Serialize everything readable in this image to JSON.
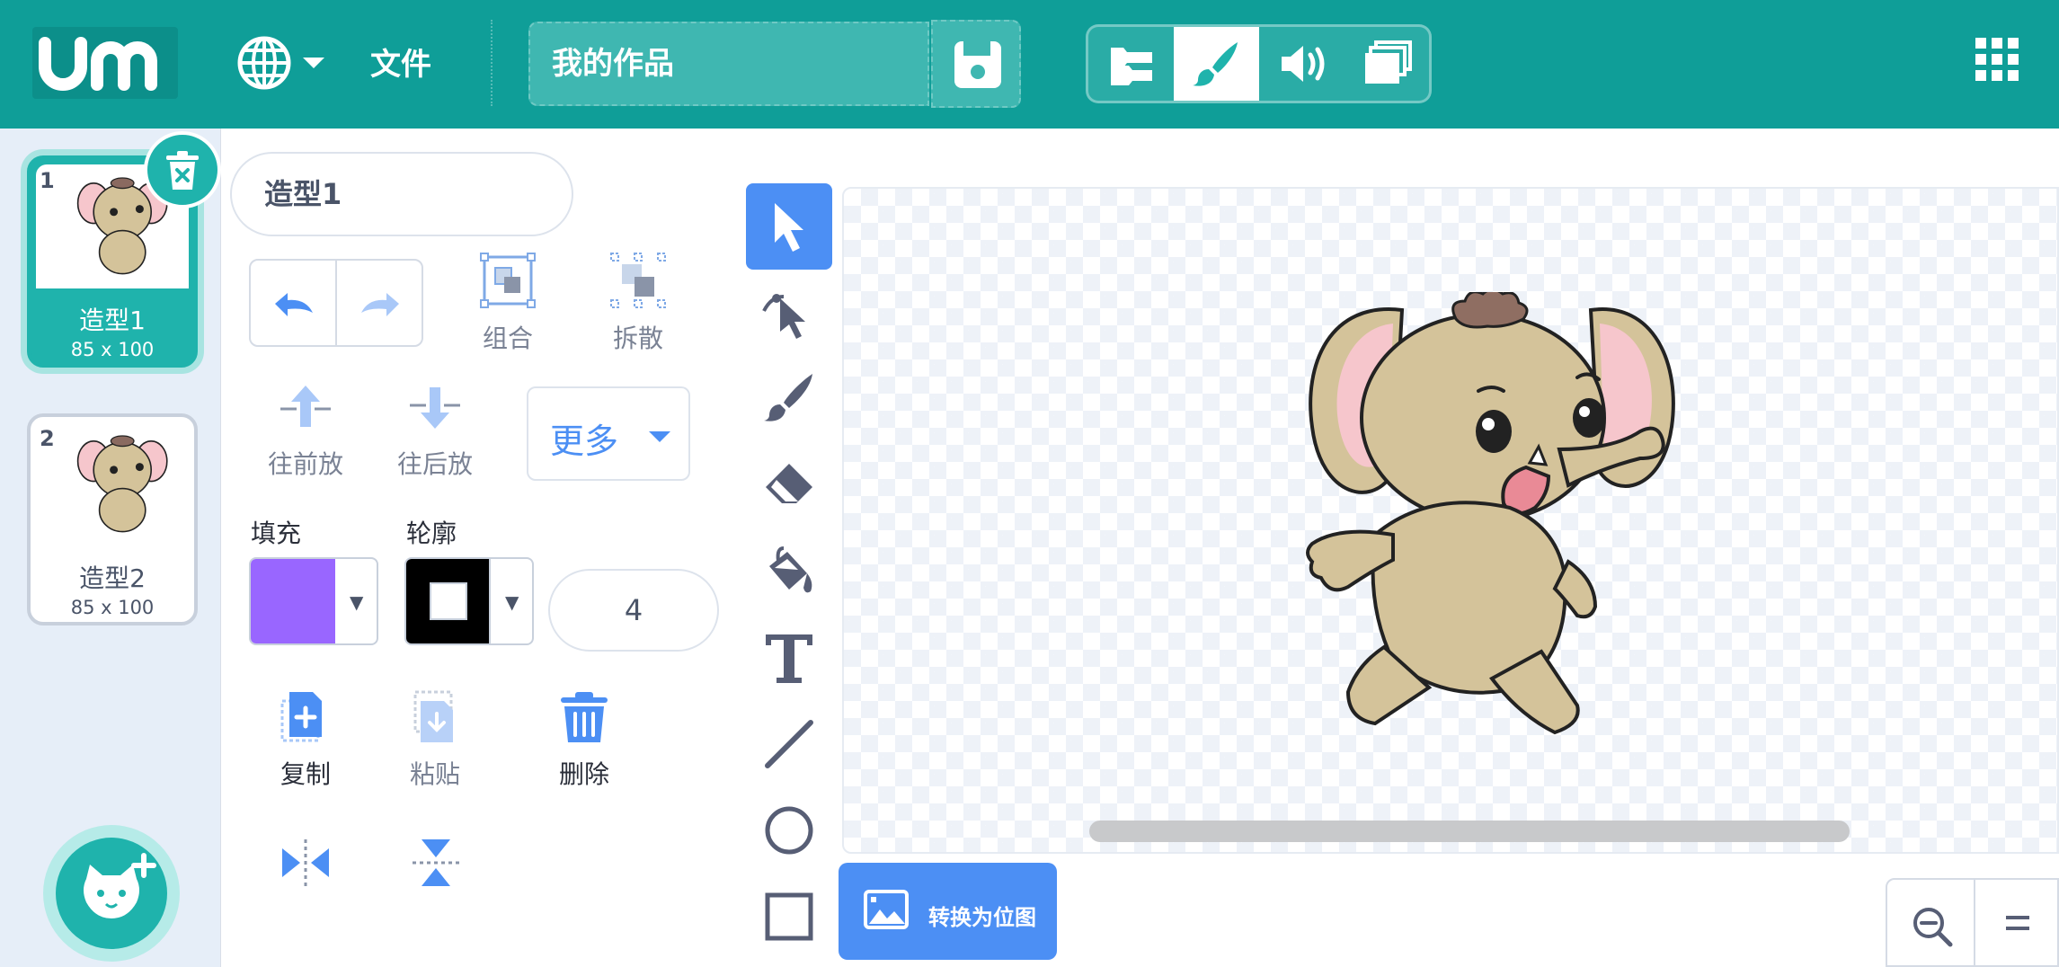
{
  "topbar": {
    "file_menu": "文件",
    "project_title": "我的作品",
    "bg_color": "#0f9e98"
  },
  "costumes": [
    {
      "index": "1",
      "name": "造型1",
      "size": "85 x 100",
      "selected": true
    },
    {
      "index": "2",
      "name": "造型2",
      "size": "85 x 100",
      "selected": false
    }
  ],
  "editor": {
    "costume_name": "造型1",
    "group_label": "组合",
    "ungroup_label": "拆散",
    "forward_label": "往前放",
    "backward_label": "往后放",
    "more_label": "更多",
    "fill_label": "填充",
    "outline_label": "轮廓",
    "fill_color": "#9966ff",
    "outline_color": "#000000",
    "stroke_width": "4",
    "copy_label": "复制",
    "paste_label": "粘贴",
    "delete_label": "删除"
  },
  "canvas": {
    "convert_bitmap_label": "转换为位图"
  },
  "colors": {
    "accent": "#4c8ff4",
    "teal": "#1fb3ac"
  }
}
